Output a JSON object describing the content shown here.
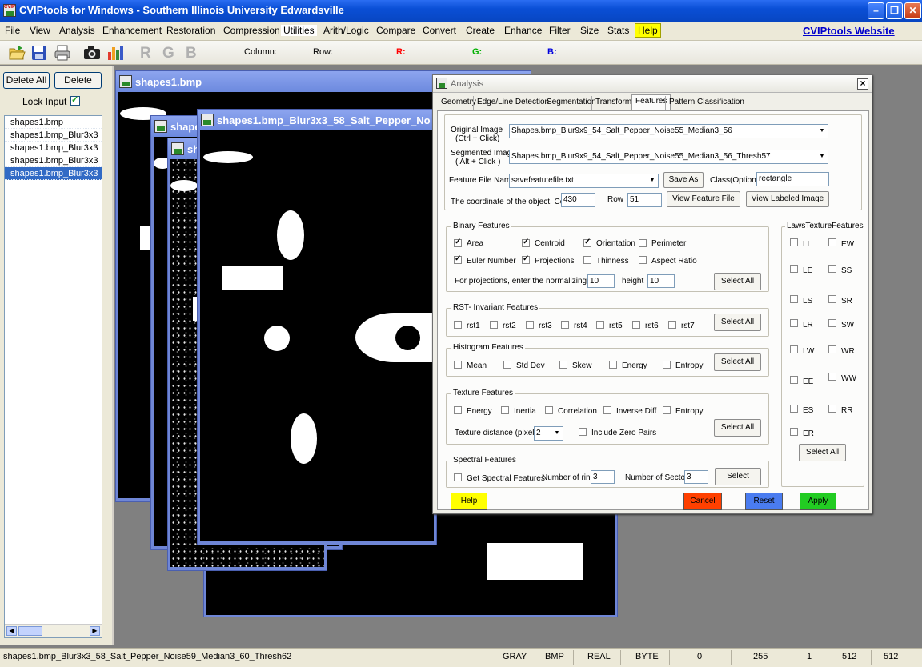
{
  "window": {
    "title": "CVIPtools for Windows - Southern Illinois University Edwardsville",
    "icon_text": "CVIP"
  },
  "menu": {
    "items": [
      "File",
      "View",
      "Analysis",
      "Enhancement",
      "Restoration",
      "Compression",
      "Utilities",
      "Arith/Logic",
      "Compare",
      "Convert",
      "Create",
      "Enhance",
      "Filter",
      "Size",
      "Stats",
      "Help"
    ],
    "website_link": "CVIPtools Website"
  },
  "toolbar": {
    "icons": [
      "open-icon",
      "save-icon",
      "print-icon",
      "camera-icon",
      "histogram-icon"
    ],
    "rgb_labels": [
      "R",
      "G",
      "B"
    ],
    "column_label": "Column:",
    "row_label": "Row:",
    "r_label": "R:",
    "g_label": "G:",
    "b_label": "B:",
    "colors": {
      "r": "#ff0000",
      "g": "#00b000",
      "b": "#0000dd"
    }
  },
  "left_panel": {
    "delete_all_label": "Delete All",
    "delete_label": "Delete",
    "lock_input_label": "Lock Input",
    "lock_input_checked": true,
    "files": [
      "shapes1.bmp",
      "shapes1.bmp_Blur3x3",
      "shapes1.bmp_Blur3x3",
      "shapes1.bmp_Blur3x3",
      "shapes1.bmp_Blur3x3"
    ],
    "selected_index": 4
  },
  "image_windows": [
    {
      "title": "shapes1.bmp"
    },
    {
      "title": "shape"
    },
    {
      "title": "sh"
    },
    {
      "title": "shapes1.bmp_Blur3x3_58_Salt_Pepper_No"
    }
  ],
  "dialog": {
    "title": "Analysis",
    "tabs": [
      "Geometry",
      "Edge/Line Detection",
      "Segmentation",
      "Transforms",
      "Features",
      "Pattern Classification"
    ],
    "active_tab": "Features",
    "original_image_label": "Original Image",
    "original_image_hint": "(Ctrl + Click)",
    "original_image_value": "Shapes.bmp_Blur9x9_54_Salt_Pepper_Noise55_Median3_56",
    "segmented_image_label": "Segmented Image",
    "segmented_image_hint": "( Alt + Click )",
    "segmented_image_value": "Shapes.bmp_Blur9x9_54_Salt_Pepper_Noise55_Median3_56_Thresh57",
    "feature_file_label": "Feature File Name",
    "feature_file_value": "savefeatutefile.txt",
    "save_as_label": "Save As",
    "class_label": "Class(Optional)",
    "class_value": "rectangle",
    "coord_label": "The coordinate of the object, Col",
    "col_value": "430",
    "row_label": "Row",
    "row_value": "51",
    "view_feature_file_label": "View Feature File",
    "view_labeled_image_label": "View Labeled Image",
    "binary": {
      "title": "Binary Features",
      "items": [
        {
          "label": "Area",
          "checked": true
        },
        {
          "label": "Centroid",
          "checked": true
        },
        {
          "label": "Orientation",
          "checked": true
        },
        {
          "label": "Perimeter",
          "checked": false
        },
        {
          "label": "Euler Number",
          "checked": true
        },
        {
          "label": "Projections",
          "checked": true
        },
        {
          "label": "Thinness",
          "checked": false
        },
        {
          "label": "Aspect Ratio",
          "checked": false
        }
      ],
      "proj_label": "For projections, enter the normalizing width:",
      "width_value": "10",
      "height_label": "height",
      "height_value": "10",
      "select_all": "Select All"
    },
    "rst": {
      "title": "RST- Invariant Features",
      "items": [
        "rst1",
        "rst2",
        "rst3",
        "rst4",
        "rst5",
        "rst6",
        "rst7"
      ],
      "select_all": "Select All"
    },
    "histogram": {
      "title": "Histogram Features",
      "items": [
        "Mean",
        "Std Dev",
        "Skew",
        "Energy",
        "Entropy"
      ],
      "select_all": "Select All"
    },
    "texture": {
      "title": "Texture Features",
      "items": [
        "Energy",
        "Inertia",
        "Correlation",
        "Inverse Diff",
        "Entropy"
      ],
      "distance_label": "Texture distance (pixels)",
      "distance_value": "2",
      "zero_pairs_label": "Include Zero Pairs",
      "select_all": "Select All"
    },
    "spectral": {
      "title": "Spectral Features",
      "get_label": "Get Spectral Features",
      "rings_label": "Number of rings",
      "rings_value": "3",
      "sectors_label": "Number of Sectors",
      "sectors_value": "3",
      "select": "Select"
    },
    "laws": {
      "title": "LawsTextureFeatures",
      "items": [
        "LL",
        "EW",
        "LE",
        "SS",
        "LS",
        "SR",
        "LR",
        "SW",
        "LW",
        "WR",
        "EE",
        "WW",
        "ES",
        "RR",
        "ER"
      ],
      "select_all": "Select All"
    },
    "buttons": {
      "help": "Help",
      "cancel": "Cancel",
      "reset": "Reset",
      "apply": "Apply"
    },
    "button_colors": {
      "help": "#ffff00",
      "cancel": "#ff4000",
      "reset": "#4a7cf0",
      "apply": "#22cc22"
    }
  },
  "status": {
    "filename": "shapes1.bmp_Blur3x3_58_Salt_Pepper_Noise59_Median3_60_Thresh62",
    "fields": [
      "GRAY",
      "BMP",
      "REAL",
      "BYTE",
      "0",
      "255",
      "1",
      "512",
      "512"
    ]
  }
}
